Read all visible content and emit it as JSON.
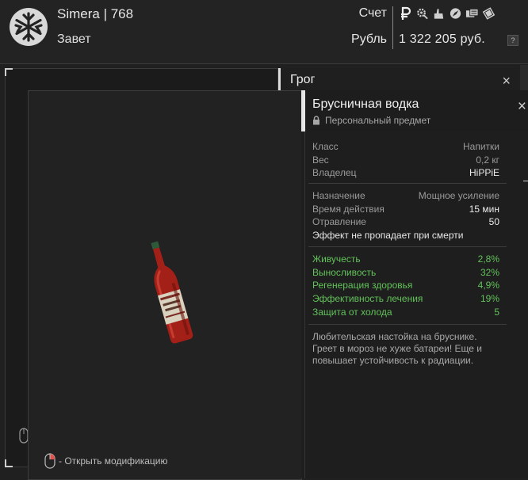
{
  "header": {
    "player": "Simera | 768",
    "faction": "Завет",
    "account_label": "Счет",
    "currency_label": "Рубль",
    "balance": "1 322 205 руб.",
    "help": "?",
    "currency_icons": [
      "ruble-icon",
      "gear-icon",
      "hand-icon",
      "compass-icon",
      "stamps-icon",
      "ticket-icon"
    ]
  },
  "background_window": {
    "title": "Грог",
    "close": "×"
  },
  "preview": {
    "mouse_hint": "- Открыть модификацию"
  },
  "item": {
    "name": "Брусничная водка",
    "subtitle": "Персональный предмет",
    "close": "×",
    "info": [
      {
        "key": "Класс",
        "value": "Напитки"
      },
      {
        "key": "Вес",
        "value": "0,2 кг"
      },
      {
        "key": "Владелец",
        "value": "HiPPiE"
      }
    ],
    "effect": [
      {
        "key": "Назначение",
        "value": "Мощное усиление"
      },
      {
        "key": "Время действия",
        "value": "15 мин"
      },
      {
        "key": "Отравление",
        "value": "50"
      }
    ],
    "effect_note": "Эффект не пропадает при смерти",
    "stats": [
      {
        "key": "Живучесть",
        "value": "2,8%"
      },
      {
        "key": "Выносливость",
        "value": "32%"
      },
      {
        "key": "Регенерация здоровья",
        "value": "4,9%"
      },
      {
        "key": "Эффективность лечения",
        "value": "19%"
      },
      {
        "key": "Защита от холода",
        "value": "5"
      }
    ],
    "description": "Любительская настойка на бруснике. Греет в мороз не хуже батареи! Еще и повышает устойчивость к радиации."
  },
  "colors": {
    "stat_green": "#62c25a",
    "accent_white": "#e6e6e6",
    "panel_bg": "#1e1e1e"
  }
}
